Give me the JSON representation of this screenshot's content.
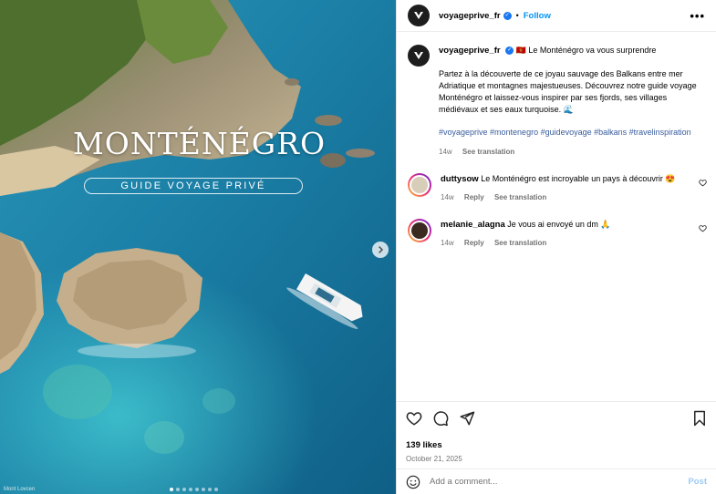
{
  "media": {
    "title": "MONTÉNÉGRO",
    "subtitle": "GUIDE VOYAGE PRIVÉ",
    "credit": "Mont Lovcen",
    "slide_count": 8,
    "active_slide": 0
  },
  "header": {
    "username": "voyageprive_fr",
    "separator": "•",
    "follow_label": "Follow",
    "more_label": "•••"
  },
  "caption": {
    "username": "voyageprive_fr",
    "first_line": "🇲🇪 Le Monténégro va vous surprendre",
    "body": "Partez à la découverte de ce joyau sauvage des Balkans entre mer Adriatique et montagnes majestueuses. Découvrez notre guide voyage Monténégro et laissez-vous inspirer par ses fjords, ses villages médiévaux et ses eaux turquoise. 🌊",
    "hashtags": "#voyageprive #montenegro #guidevoyage #balkans #travelinspiration",
    "time": "14w",
    "translate": "See translation"
  },
  "comments": [
    {
      "username": "duttysow",
      "text": "Le Monténégro est incroyable un pays à découvrir 😍",
      "time": "14w",
      "reply": "Reply",
      "translate": "See translation",
      "avatar_color": "#d8cdb8"
    },
    {
      "username": "melanie_alagna",
      "text": "Je vous ai envoyé un dm 🙏",
      "time": "14w",
      "reply": "Reply",
      "translate": "See translation",
      "avatar_color": "#3a2a22"
    }
  ],
  "stats": {
    "likes": "139 likes",
    "date": "October 21, 2025"
  },
  "add_comment": {
    "placeholder": "Add a comment...",
    "post_label": "Post"
  },
  "colors": {
    "accent": "#0095f6",
    "hashtag": "#385c9c",
    "muted": "#737373",
    "post_disabled": "#9ccbf4"
  }
}
